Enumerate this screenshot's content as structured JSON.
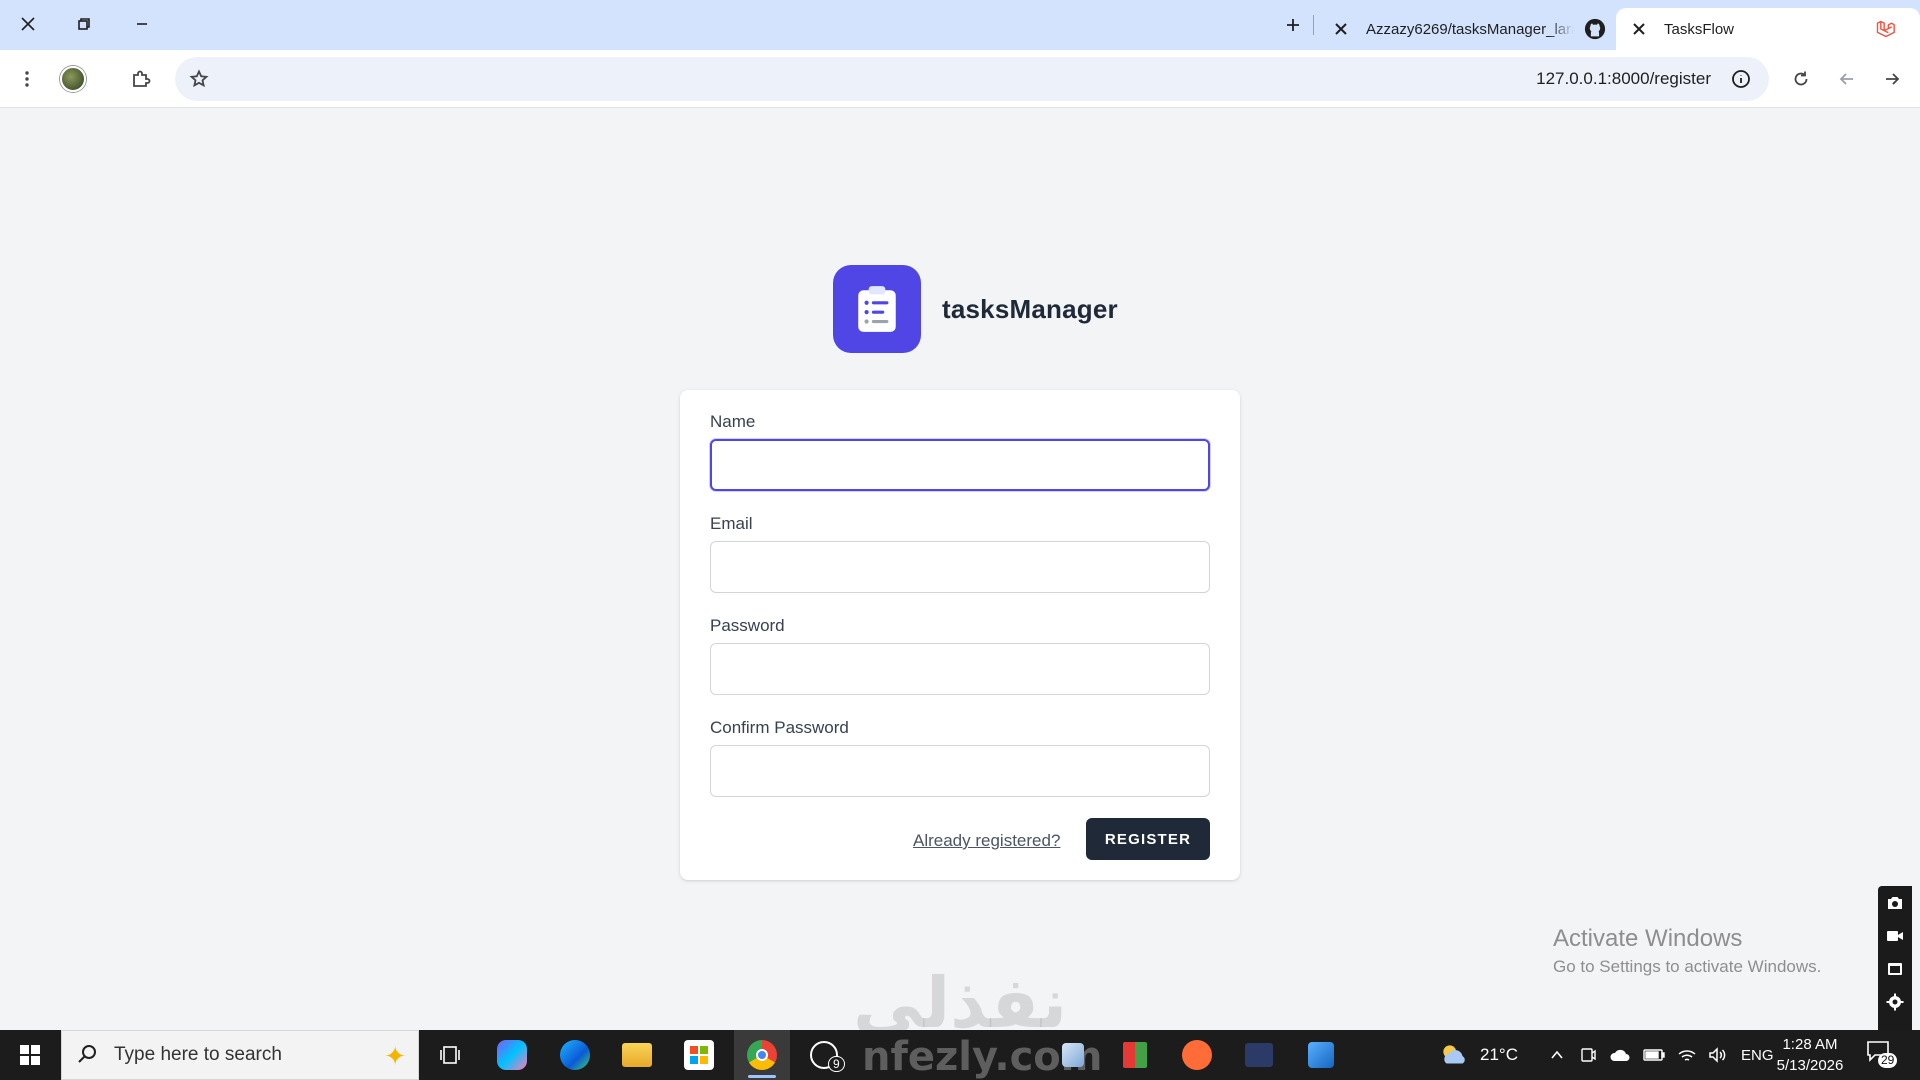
{
  "browser": {
    "tabs": [
      {
        "title": "Azzazy6269/tasksManager_larav",
        "favicon": "github-icon",
        "active": false
      },
      {
        "title": "TasksFlow",
        "favicon": "laravel-icon",
        "active": true
      }
    ],
    "url": "127.0.0.1:8000/register"
  },
  "brand": {
    "name": "tasksManager",
    "logo_color": "#4f46e5"
  },
  "form": {
    "name_label": "Name",
    "name_value": "",
    "email_label": "Email",
    "email_value": "",
    "password_label": "Password",
    "password_value": "",
    "confirm_label": "Confirm Password",
    "confirm_value": "",
    "login_link": "Already registered?",
    "submit_label": "REGISTER",
    "submit_color": "#1f2937"
  },
  "watermark": {
    "arabic": "نفذلي",
    "latin": "nfezly.com"
  },
  "activation": {
    "title": "Activate Windows",
    "subtitle": "Go to Settings to activate Windows."
  },
  "taskbar": {
    "search_placeholder": "Type here to search",
    "whatsapp_badge": "9",
    "weather": "21°C",
    "language": "ENG",
    "time": "1:28 AM",
    "date": "5/13/2026",
    "notification_count": "29"
  }
}
